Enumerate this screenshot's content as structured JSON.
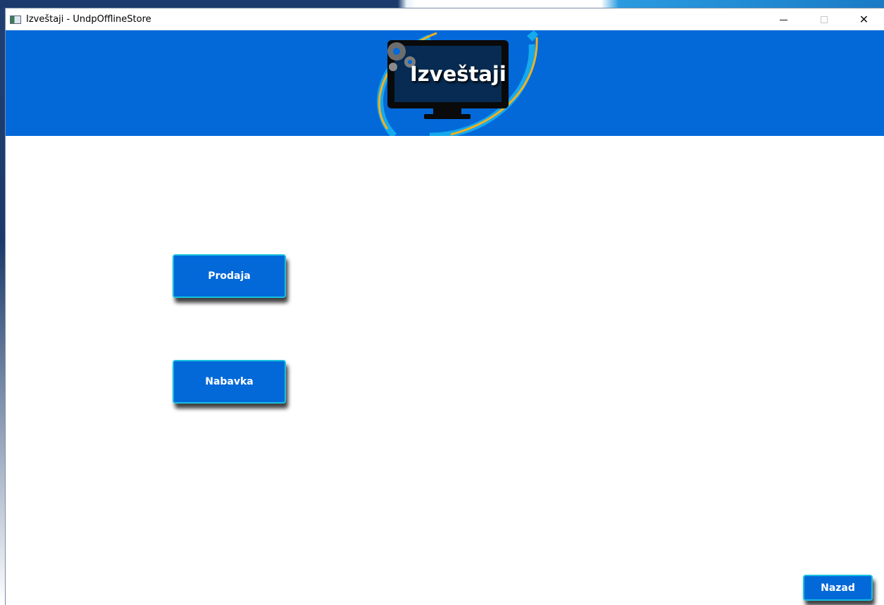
{
  "window": {
    "title": "Izveštaji - UndpOfflineStore",
    "controls": {
      "minimize": "minimize-icon",
      "maximize": "maximize-icon",
      "close": "✕"
    }
  },
  "header": {
    "title": "Izveštaji",
    "background": "#0369d9"
  },
  "buttons": {
    "prodaja": "Prodaja",
    "nabavka": "Nabavka",
    "nazad": "Nazad"
  },
  "colors": {
    "accent": "#0369d9",
    "button_border": "#17c0e0"
  }
}
